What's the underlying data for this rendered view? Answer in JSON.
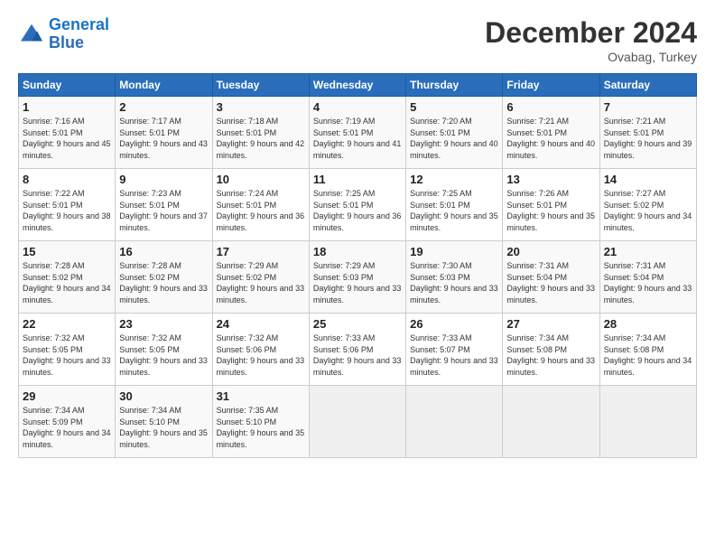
{
  "logo": {
    "line1": "General",
    "line2": "Blue"
  },
  "title": "December 2024",
  "location": "Ovabag, Turkey",
  "days_header": [
    "Sunday",
    "Monday",
    "Tuesday",
    "Wednesday",
    "Thursday",
    "Friday",
    "Saturday"
  ],
  "weeks": [
    [
      {
        "day": "1",
        "rise": "7:16 AM",
        "set": "5:01 PM",
        "daylight": "9 hours and 45 minutes."
      },
      {
        "day": "2",
        "rise": "7:17 AM",
        "set": "5:01 PM",
        "daylight": "9 hours and 43 minutes."
      },
      {
        "day": "3",
        "rise": "7:18 AM",
        "set": "5:01 PM",
        "daylight": "9 hours and 42 minutes."
      },
      {
        "day": "4",
        "rise": "7:19 AM",
        "set": "5:01 PM",
        "daylight": "9 hours and 41 minutes."
      },
      {
        "day": "5",
        "rise": "7:20 AM",
        "set": "5:01 PM",
        "daylight": "9 hours and 40 minutes."
      },
      {
        "day": "6",
        "rise": "7:21 AM",
        "set": "5:01 PM",
        "daylight": "9 hours and 40 minutes."
      },
      {
        "day": "7",
        "rise": "7:21 AM",
        "set": "5:01 PM",
        "daylight": "9 hours and 39 minutes."
      }
    ],
    [
      {
        "day": "8",
        "rise": "7:22 AM",
        "set": "5:01 PM",
        "daylight": "9 hours and 38 minutes."
      },
      {
        "day": "9",
        "rise": "7:23 AM",
        "set": "5:01 PM",
        "daylight": "9 hours and 37 minutes."
      },
      {
        "day": "10",
        "rise": "7:24 AM",
        "set": "5:01 PM",
        "daylight": "9 hours and 36 minutes."
      },
      {
        "day": "11",
        "rise": "7:25 AM",
        "set": "5:01 PM",
        "daylight": "9 hours and 36 minutes."
      },
      {
        "day": "12",
        "rise": "7:25 AM",
        "set": "5:01 PM",
        "daylight": "9 hours and 35 minutes."
      },
      {
        "day": "13",
        "rise": "7:26 AM",
        "set": "5:01 PM",
        "daylight": "9 hours and 35 minutes."
      },
      {
        "day": "14",
        "rise": "7:27 AM",
        "set": "5:02 PM",
        "daylight": "9 hours and 34 minutes."
      }
    ],
    [
      {
        "day": "15",
        "rise": "7:28 AM",
        "set": "5:02 PM",
        "daylight": "9 hours and 34 minutes."
      },
      {
        "day": "16",
        "rise": "7:28 AM",
        "set": "5:02 PM",
        "daylight": "9 hours and 33 minutes."
      },
      {
        "day": "17",
        "rise": "7:29 AM",
        "set": "5:02 PM",
        "daylight": "9 hours and 33 minutes."
      },
      {
        "day": "18",
        "rise": "7:29 AM",
        "set": "5:03 PM",
        "daylight": "9 hours and 33 minutes."
      },
      {
        "day": "19",
        "rise": "7:30 AM",
        "set": "5:03 PM",
        "daylight": "9 hours and 33 minutes."
      },
      {
        "day": "20",
        "rise": "7:31 AM",
        "set": "5:04 PM",
        "daylight": "9 hours and 33 minutes."
      },
      {
        "day": "21",
        "rise": "7:31 AM",
        "set": "5:04 PM",
        "daylight": "9 hours and 33 minutes."
      }
    ],
    [
      {
        "day": "22",
        "rise": "7:32 AM",
        "set": "5:05 PM",
        "daylight": "9 hours and 33 minutes."
      },
      {
        "day": "23",
        "rise": "7:32 AM",
        "set": "5:05 PM",
        "daylight": "9 hours and 33 minutes."
      },
      {
        "day": "24",
        "rise": "7:32 AM",
        "set": "5:06 PM",
        "daylight": "9 hours and 33 minutes."
      },
      {
        "day": "25",
        "rise": "7:33 AM",
        "set": "5:06 PM",
        "daylight": "9 hours and 33 minutes."
      },
      {
        "day": "26",
        "rise": "7:33 AM",
        "set": "5:07 PM",
        "daylight": "9 hours and 33 minutes."
      },
      {
        "day": "27",
        "rise": "7:34 AM",
        "set": "5:08 PM",
        "daylight": "9 hours and 33 minutes."
      },
      {
        "day": "28",
        "rise": "7:34 AM",
        "set": "5:08 PM",
        "daylight": "9 hours and 34 minutes."
      }
    ],
    [
      {
        "day": "29",
        "rise": "7:34 AM",
        "set": "5:09 PM",
        "daylight": "9 hours and 34 minutes."
      },
      {
        "day": "30",
        "rise": "7:34 AM",
        "set": "5:10 PM",
        "daylight": "9 hours and 35 minutes."
      },
      {
        "day": "31",
        "rise": "7:35 AM",
        "set": "5:10 PM",
        "daylight": "9 hours and 35 minutes."
      },
      null,
      null,
      null,
      null
    ]
  ]
}
